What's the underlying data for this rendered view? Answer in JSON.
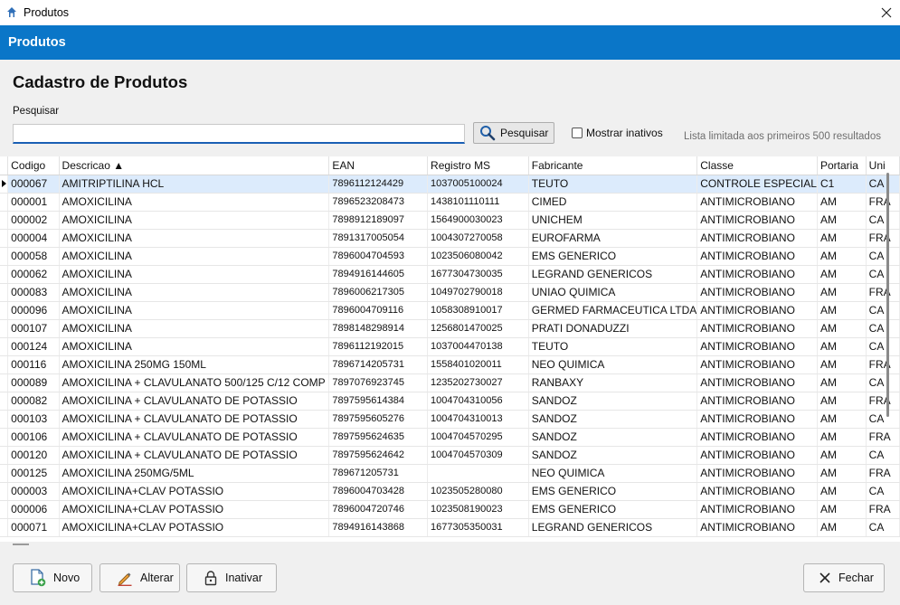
{
  "window": {
    "title": "Produtos",
    "app_icon": "app-logo-icon",
    "close_icon": "close-icon"
  },
  "banner": {
    "title": "Produtos"
  },
  "page": {
    "heading": "Cadastro de Produtos"
  },
  "search": {
    "label": "Pesquisar",
    "value": "",
    "placeholder": "",
    "button_label": "Pesquisar",
    "button_icon": "search-icon",
    "show_inactive_label": "Mostrar inativos",
    "show_inactive_checked": false,
    "limit_note": "Lista limitada aos primeiros 500 resultados"
  },
  "table": {
    "columns": [
      "Codigo",
      "Descricao ▲",
      "EAN",
      "Registro MS",
      "Fabricante",
      "Classe",
      "Portaria",
      "Uni"
    ],
    "selected_row": 0,
    "rows": [
      [
        "000067",
        "AMITRIPTILINA HCL",
        "7896112124429",
        "1037005100024",
        "TEUTO",
        "CONTROLE ESPECIAL",
        "C1",
        "CA"
      ],
      [
        "000001",
        "AMOXICILINA",
        "7896523208473",
        "1438101110111",
        "CIMED",
        "ANTIMICROBIANO",
        "AM",
        "FRA"
      ],
      [
        "000002",
        "AMOXICILINA",
        "7898912189097",
        "1564900030023",
        "UNICHEM",
        "ANTIMICROBIANO",
        "AM",
        "CA"
      ],
      [
        "000004",
        "AMOXICILINA",
        "7891317005054",
        "1004307270058",
        "EUROFARMA",
        "ANTIMICROBIANO",
        "AM",
        "FRA"
      ],
      [
        "000058",
        "AMOXICILINA",
        "7896004704593",
        "1023506080042",
        "EMS GENERICO",
        "ANTIMICROBIANO",
        "AM",
        "CA"
      ],
      [
        "000062",
        "AMOXICILINA",
        "7894916144605",
        "1677304730035",
        "LEGRAND GENERICOS",
        "ANTIMICROBIANO",
        "AM",
        "CA"
      ],
      [
        "000083",
        "AMOXICILINA",
        "7896006217305",
        "1049702790018",
        "UNIAO QUIMICA",
        "ANTIMICROBIANO",
        "AM",
        "FRA"
      ],
      [
        "000096",
        "AMOXICILINA",
        "7896004709116",
        "1058308910017",
        "GERMED FARMACEUTICA LTDA",
        "ANTIMICROBIANO",
        "AM",
        "CA"
      ],
      [
        "000107",
        "AMOXICILINA",
        "7898148298914",
        "1256801470025",
        "PRATI DONADUZZI",
        "ANTIMICROBIANO",
        "AM",
        "CA"
      ],
      [
        "000124",
        "AMOXICILINA",
        "7896112192015",
        "1037004470138",
        "TEUTO",
        "ANTIMICROBIANO",
        "AM",
        "CA"
      ],
      [
        "000116",
        "AMOXICILINA  250MG 150ML",
        "7896714205731",
        "1558401020011",
        "NEO QUIMICA",
        "ANTIMICROBIANO",
        "AM",
        "FRA"
      ],
      [
        "000089",
        "AMOXICILINA + CLAVULANATO 500/125 C/12 COMP",
        "7897076923745",
        "1235202730027",
        "RANBAXY",
        "ANTIMICROBIANO",
        "AM",
        "CA"
      ],
      [
        "000082",
        "AMOXICILINA + CLAVULANATO DE POTASSIO",
        "7897595614384",
        "1004704310056",
        "SANDOZ",
        "ANTIMICROBIANO",
        "AM",
        "FRA"
      ],
      [
        "000103",
        "AMOXICILINA + CLAVULANATO DE POTASSIO",
        "7897595605276",
        "1004704310013",
        "SANDOZ",
        "ANTIMICROBIANO",
        "AM",
        "CA"
      ],
      [
        "000106",
        "AMOXICILINA + CLAVULANATO DE POTASSIO",
        "7897595624635",
        "1004704570295",
        "SANDOZ",
        "ANTIMICROBIANO",
        "AM",
        "FRA"
      ],
      [
        "000120",
        "AMOXICILINA + CLAVULANATO DE POTASSIO",
        "7897595624642",
        "1004704570309",
        "SANDOZ",
        "ANTIMICROBIANO",
        "AM",
        "CA"
      ],
      [
        "000125",
        "AMOXICILINA 250MG/5ML",
        "789671205731",
        "",
        "NEO QUIMICA",
        "ANTIMICROBIANO",
        "AM",
        "FRA"
      ],
      [
        "000003",
        "AMOXICILINA+CLAV POTASSIO",
        "7896004703428",
        "1023505280080",
        "EMS GENERICO",
        "ANTIMICROBIANO",
        "AM",
        "CA"
      ],
      [
        "000006",
        "AMOXICILINA+CLAV POTASSIO",
        "7896004720746",
        "1023508190023",
        "EMS GENERICO",
        "ANTIMICROBIANO",
        "AM",
        "FRA"
      ],
      [
        "000071",
        "AMOXICILINA+CLAV POTASSIO",
        "7894916143868",
        "1677305350031",
        "LEGRAND GENERICOS",
        "ANTIMICROBIANO",
        "AM",
        "CA"
      ]
    ]
  },
  "footer": {
    "new_label": "Novo",
    "new_icon": "new-document-icon",
    "edit_label": "Alterar",
    "edit_icon": "pencil-icon",
    "deactivate_label": "Inativar",
    "deactivate_icon": "lock-icon",
    "close_label": "Fechar",
    "close_icon": "close-x-icon"
  },
  "colors": {
    "banner": "#0a76c8",
    "selection": "#dcebfc",
    "input_underline": "#1a5fb4"
  }
}
